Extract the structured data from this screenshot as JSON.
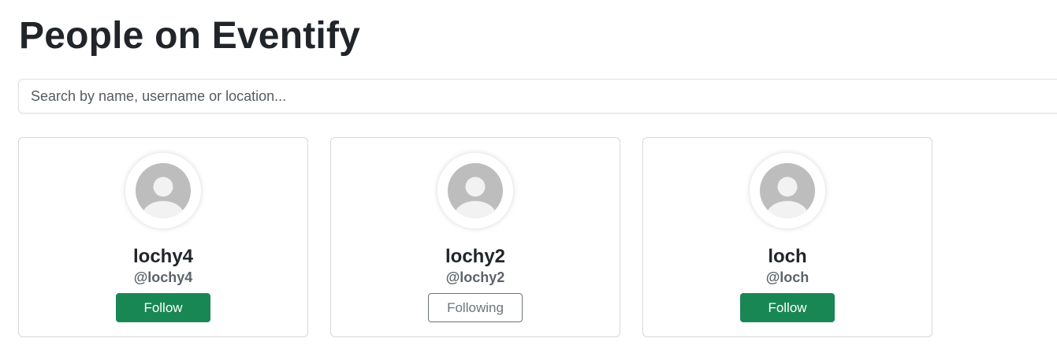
{
  "page_title": "People on Eventify",
  "search": {
    "value": "",
    "placeholder": "Search by name, username or location..."
  },
  "people": [
    {
      "name": "lochy4",
      "username": "@lochy4",
      "button_label": "Follow",
      "following": false
    },
    {
      "name": "lochy2",
      "username": "@lochy2",
      "button_label": "Following",
      "following": true
    },
    {
      "name": "loch",
      "username": "@loch",
      "button_label": "Follow",
      "following": false
    }
  ],
  "colors": {
    "follow_button": "#198754",
    "following_button_border": "#6c757d",
    "avatar_background": "#bdbdbd",
    "avatar_figure": "#f2f2f2"
  },
  "icons": {
    "avatar": "default-user-avatar-icon"
  }
}
